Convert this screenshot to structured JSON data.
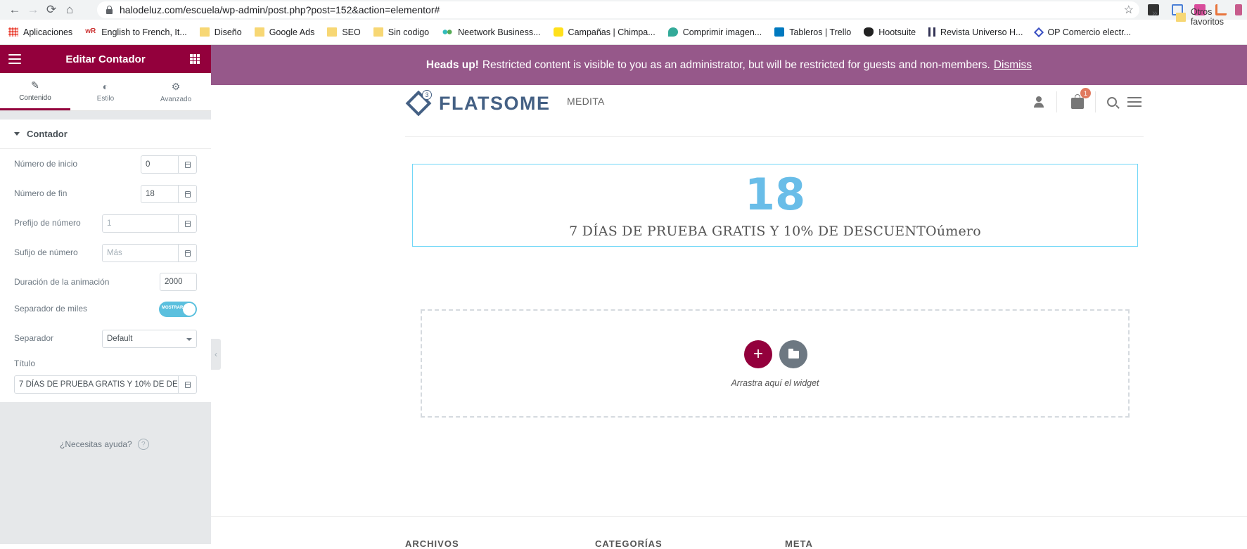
{
  "browser": {
    "url": "halodeluz.com/escuela/wp-admin/post.php?post=152&action=elementor#",
    "bookmarks": [
      {
        "label": "Aplicaciones",
        "icon": "apps-grid-icon"
      },
      {
        "label": "English to French, It...",
        "icon": "wordreference-icon"
      },
      {
        "label": "Diseño",
        "icon": "folder-icon"
      },
      {
        "label": "Google Ads",
        "icon": "folder-icon"
      },
      {
        "label": "SEO",
        "icon": "folder-icon"
      },
      {
        "label": "Sin codigo",
        "icon": "folder-icon"
      },
      {
        "label": "Neetwork Business...",
        "icon": "neetwork-icon"
      },
      {
        "label": "Campañas | Chimpa...",
        "icon": "mailchimp-icon"
      },
      {
        "label": "Comprimir imagen...",
        "icon": "compress-icon"
      },
      {
        "label": "Tableros | Trello",
        "icon": "trello-icon"
      },
      {
        "label": "Hootsuite",
        "icon": "hootsuite-icon"
      },
      {
        "label": "Revista Universo H...",
        "icon": "revista-icon"
      },
      {
        "label": "OP Comercio electr...",
        "icon": "op-icon"
      }
    ],
    "more": "»",
    "other_bookmarks": "Otros favoritos"
  },
  "editor": {
    "title": "Editar Contador",
    "tabs": [
      {
        "label": "Contenido",
        "icon": "pencil-icon",
        "active": true
      },
      {
        "label": "Estilo",
        "icon": "contrast-icon",
        "active": false
      },
      {
        "label": "Avanzado",
        "icon": "gear-icon",
        "active": false
      }
    ],
    "section": "Contador",
    "fields": {
      "start": {
        "label": "Número de inicio",
        "value": "0"
      },
      "end": {
        "label": "Número de fin",
        "value": "18"
      },
      "prefix": {
        "label": "Prefijo de número",
        "placeholder": "1"
      },
      "suffix": {
        "label": "Sufijo de número",
        "placeholder": "Más"
      },
      "duration": {
        "label": "Duración de la animación",
        "value": "2000"
      },
      "thousand_sep": {
        "label": "Separador de miles",
        "toggle_text": "MOSTRAR",
        "on": true
      },
      "separator": {
        "label": "Separador",
        "value": "Default"
      },
      "title": {
        "label": "Título",
        "value": "7 DÍAS DE PRUEBA GRATIS Y 10% DE DESCUENTOúmero"
      }
    },
    "help": "¿Necesitas ayuda?",
    "collapse": "‹"
  },
  "notice": {
    "bold": "Heads up!",
    "text": "Restricted content is visible to you as an administrator, but will be restricted for guests and non-members.",
    "dismiss": "Dismiss"
  },
  "site": {
    "logo": "FLATSOME",
    "logo_badge": "3",
    "nav": "MEDITA",
    "cart_count": "1"
  },
  "counter": {
    "number": "18",
    "title": "7 DÍAS DE PRUEBA GRATIS Y 10% DE DESCUENTOúmero"
  },
  "dropzone": {
    "add": "+",
    "text": "Arrastra aquí el widget"
  },
  "footer": {
    "headings": [
      "ARCHIVOS",
      "CATEGORÍAS",
      "META"
    ]
  },
  "colors": {
    "elementor_accent": "#93003c",
    "notice_bg": "#96588a",
    "counter_number": "#69bde8",
    "flatsome_blue": "#446084"
  }
}
